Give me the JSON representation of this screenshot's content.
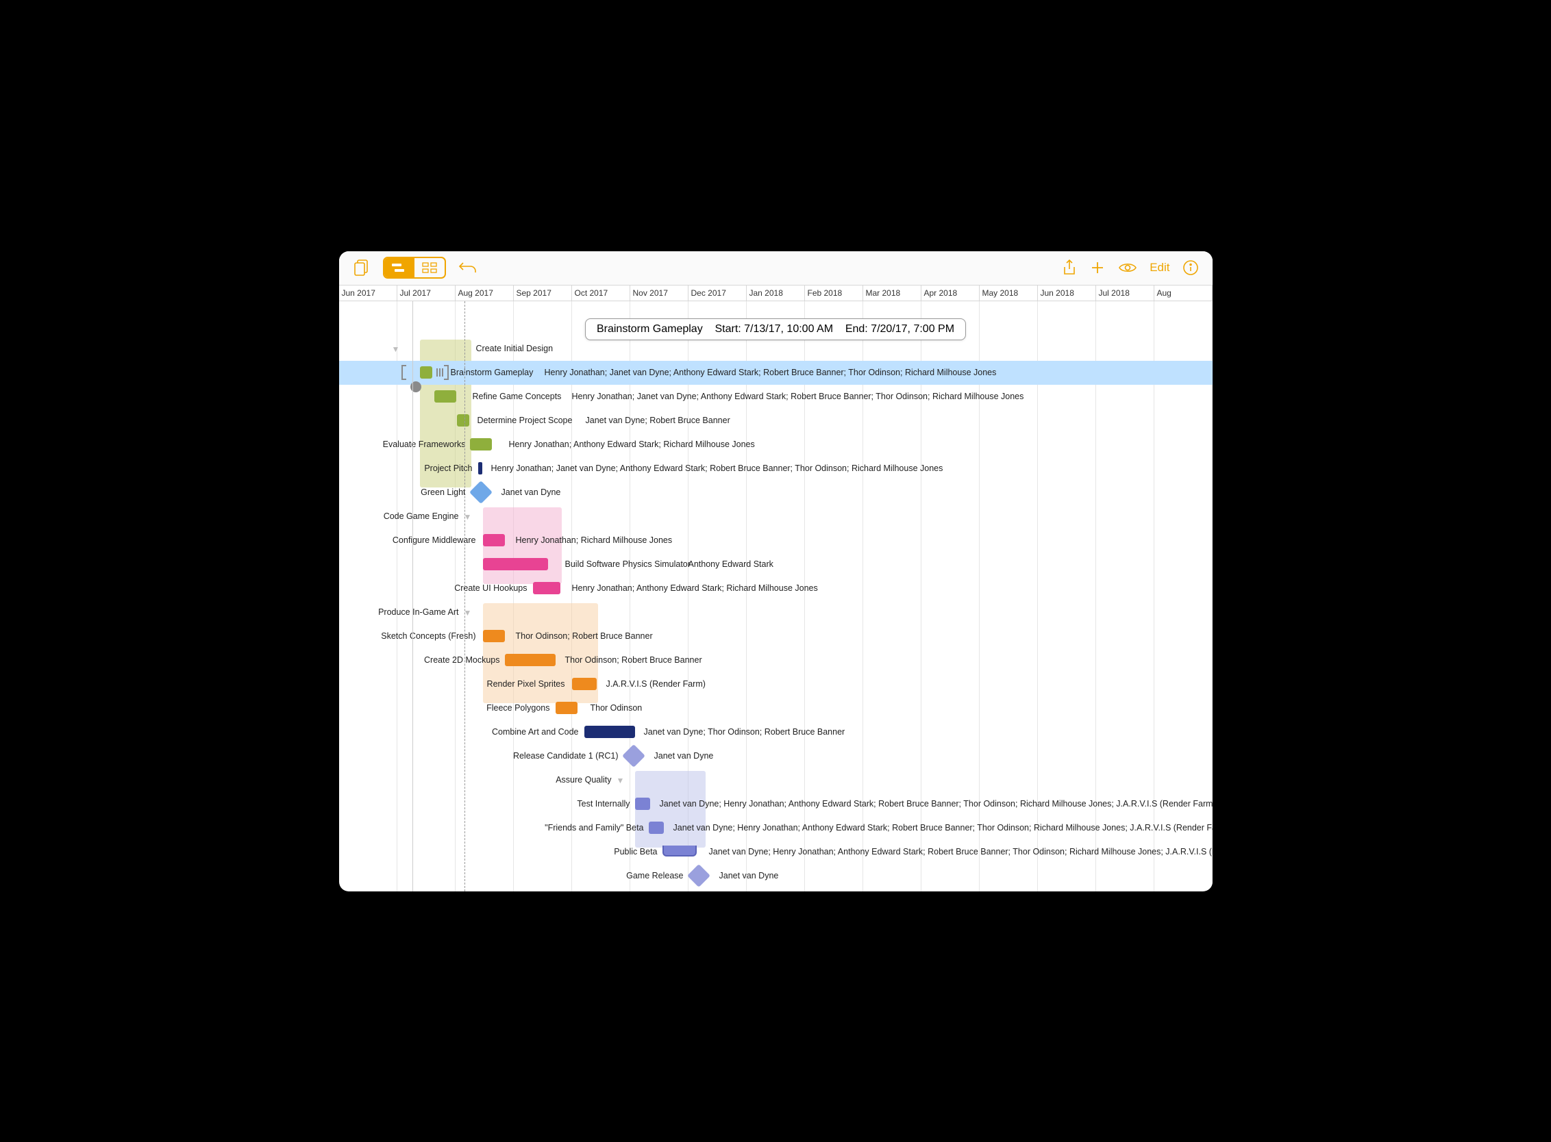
{
  "toolbar": {
    "edit": "Edit"
  },
  "months": [
    "Jun 2017",
    "Jul 2017",
    "Aug 2017",
    "Sep 2017",
    "Oct 2017",
    "Nov 2017",
    "Dec 2017",
    "Jan 2018",
    "Feb 2018",
    "Mar 2018",
    "Apr 2018",
    "May 2018",
    "Jun 2018",
    "Jul 2018",
    "Aug"
  ],
  "tooltip": {
    "title": "Brainstorm Gameplay",
    "start": "Start: 7/13/17, 10:00 AM",
    "end": "End: 7/20/17, 7:00 PM"
  },
  "tasks": {
    "create_initial_design": {
      "label": "Create Initial Design"
    },
    "brainstorm_gameplay": {
      "label": "Brainstorm Gameplay",
      "assignees": "Henry Jonathan; Janet van Dyne; Anthony Edward Stark; Robert Bruce Banner; Thor Odinson; Richard Milhouse Jones"
    },
    "refine_game_concepts": {
      "label": "Refine Game Concepts",
      "assignees": "Henry Jonathan; Janet van Dyne; Anthony Edward Stark; Robert Bruce Banner; Thor Odinson; Richard Milhouse Jones"
    },
    "determine_project_scope": {
      "label": "Determine Project Scope",
      "assignees": "Janet van Dyne; Robert Bruce Banner"
    },
    "evaluate_frameworks": {
      "label": "Evaluate Frameworks",
      "assignees": "Henry Jonathan; Anthony Edward Stark; Richard Milhouse Jones"
    },
    "project_pitch": {
      "label": "Project Pitch",
      "assignees": "Henry Jonathan; Janet van Dyne; Anthony Edward Stark; Robert Bruce Banner; Thor Odinson; Richard Milhouse Jones"
    },
    "green_light": {
      "label": "Green Light",
      "assignees": "Janet van Dyne"
    },
    "code_game_engine": {
      "label": "Code Game Engine"
    },
    "configure_middleware": {
      "label": "Configure Middleware",
      "assignees": "Henry Jonathan; Richard Milhouse Jones"
    },
    "build_physics": {
      "label": "Build Software Physics Simulator",
      "assignees": "Anthony Edward Stark"
    },
    "create_ui_hookups": {
      "label": "Create UI Hookups",
      "assignees": "Henry Jonathan; Anthony Edward Stark; Richard Milhouse Jones"
    },
    "produce_art": {
      "label": "Produce In-Game Art"
    },
    "sketch_concepts": {
      "label": "Sketch Concepts (Fresh)",
      "assignees": "Thor Odinson; Robert Bruce Banner"
    },
    "create_2d_mockups": {
      "label": "Create 2D Mockups",
      "assignees": "Thor Odinson; Robert Bruce Banner"
    },
    "render_pixel_sprites": {
      "label": "Render Pixel Sprites",
      "assignees": "J.A.R.V.I.S (Render Farm)"
    },
    "fleece_polygons": {
      "label": "Fleece Polygons",
      "assignees": "Thor Odinson"
    },
    "combine_art_code": {
      "label": "Combine Art and Code",
      "assignees": "Janet van Dyne; Thor Odinson; Robert Bruce Banner"
    },
    "rc1": {
      "label": "Release Candidate 1 (RC1)",
      "assignees": "Janet van Dyne"
    },
    "assure_quality": {
      "label": "Assure Quality"
    },
    "test_internally": {
      "label": "Test Internally",
      "assignees": "Janet van Dyne; Henry Jonathan; Anthony Edward Stark; Robert Bruce Banner; Thor Odinson; Richard Milhouse Jones; J.A.R.V.I.S (Render Farm)"
    },
    "friends_family": {
      "label": "\"Friends and Family\" Beta",
      "assignees": "Janet van Dyne; Henry Jonathan; Anthony Edward Stark; Robert Bruce Banner; Thor Odinson; Richard Milhouse Jones; J.A.R.V.I.S (Render Farm)"
    },
    "public_beta": {
      "label": "Public Beta",
      "assignees": "Janet van Dyne; Henry Jonathan; Anthony Edward Stark; Robert Bruce Banner; Thor Odinson; Richard Milhouse Jones; J.A.R.V.I.S (Render Fa"
    },
    "game_release": {
      "label": "Game Release",
      "assignees": "Janet van Dyne"
    }
  },
  "colors": {
    "olive_group": "#c9d07c",
    "olive": "#8faf3c",
    "olive_dark": "#6c8b2a",
    "navy": "#1c2d73",
    "blue_diamond": "#6fa8e8",
    "pink_group": "#f4b0cf",
    "pink": "#e84393",
    "orange_group": "#f7cfa3",
    "orange": "#ee8a1e",
    "navy_bar": "#1c2d73",
    "lavender_diamond": "#9aa0de",
    "lavender_group": "#bcc1e9",
    "lavender": "#7b82d4"
  }
}
